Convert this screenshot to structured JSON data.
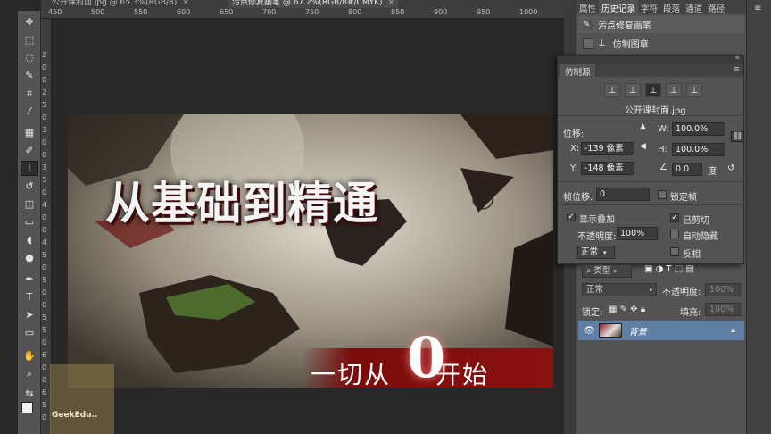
{
  "doc_tabs": [
    {
      "label": "公开课封面.jpg @ 65.3%(RGB/8)",
      "close": "×"
    },
    {
      "label": "污点修复画笔 @ 67.2%(RGB/8#/CMYK)",
      "close": "×"
    }
  ],
  "ruler_top_ticks": [
    "450",
    "500",
    "550",
    "600",
    "650",
    "700",
    "750",
    "800",
    "850",
    "900",
    "950",
    "1000"
  ],
  "ruler_left_ticks": [
    "2",
    "0",
    "0",
    "2",
    "5",
    "0",
    "3",
    "0",
    "0",
    "3",
    "5",
    "0",
    "4",
    "0",
    "0",
    "4",
    "5",
    "0",
    "5",
    "0",
    "0",
    "5",
    "5",
    "0",
    "6",
    "0",
    "0",
    "6",
    "5",
    "0"
  ],
  "artwork": {
    "title": "从基础到精通",
    "subtitle_left": "一切从",
    "subtitle_zero": "0",
    "subtitle_right": "开始"
  },
  "watermark": {
    "text": "GeekEdu.."
  },
  "right_tabs": [
    "属性",
    "历史记录",
    "字符",
    "段落",
    "通道",
    "路径"
  ],
  "right_tabs_active": 1,
  "history": [
    {
      "label": "污点修复画笔",
      "icon": "brush-icon"
    },
    {
      "label": "仿制图章",
      "icon": "stamp-icon"
    }
  ],
  "clone_source": {
    "tab": "仿制源",
    "file": "公开课封面.jpg",
    "offset_label": "位移:",
    "x_label": "X:",
    "x_value": "-139 像素",
    "y_label": "Y:",
    "y_value": "-148 像素",
    "w_label": "W:",
    "w_value": "100.0%",
    "h_label": "H:",
    "h_value": "100.0%",
    "angle_value": "0.0",
    "angle_unit": "度",
    "frame_offset_label": "帧位移:",
    "frame_offset_value": "0",
    "lock_frame_label": "锁定帧",
    "show_overlay_label": "显示叠加",
    "clipped_label": "已剪切",
    "opacity_label": "不透明度:",
    "opacity_value": "100%",
    "auto_hide_label": "自动隐藏",
    "mode_value": "正常",
    "invert_label": "反相"
  },
  "layers": {
    "filter_label": "类型",
    "blend_mode": "正常",
    "opacity_label": "不透明度:",
    "opacity_value": "100%",
    "lock_label": "锁定:",
    "fill_label": "填充:",
    "fill_value": "100%",
    "layer_name": "背景"
  },
  "colors": {
    "accent_red": "#8d1111",
    "layer_selected": "#5f7ea4"
  }
}
